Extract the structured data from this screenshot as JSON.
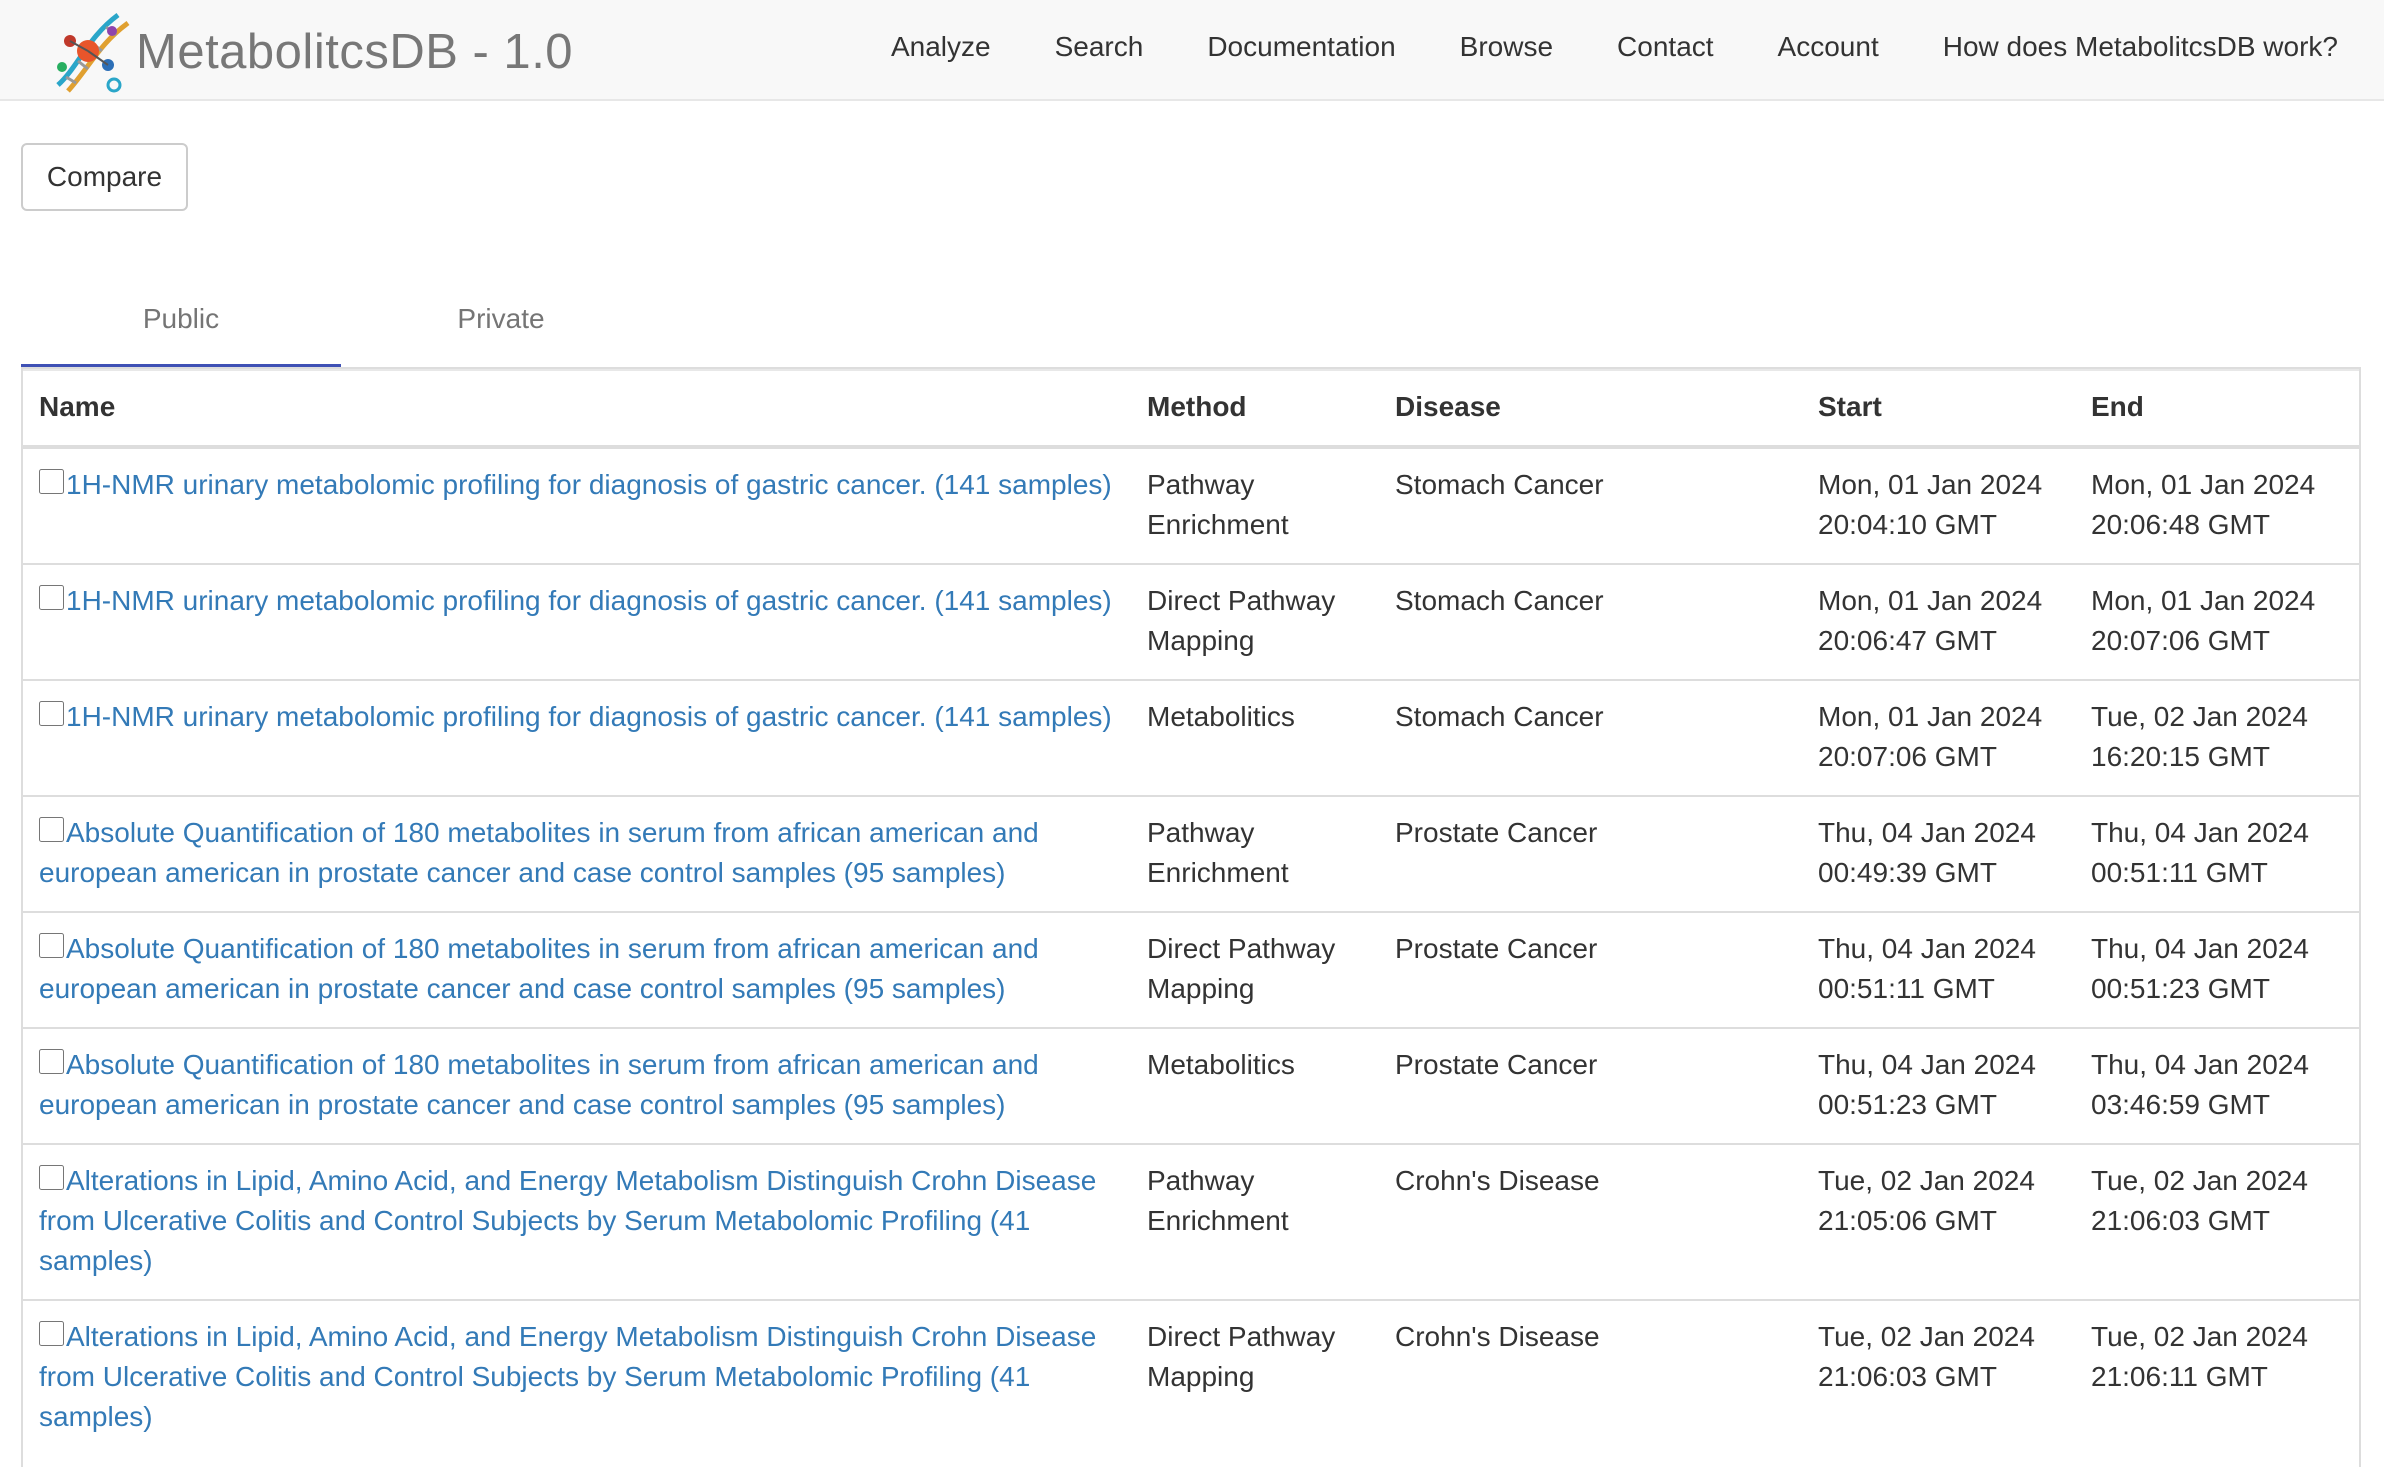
{
  "brand": {
    "title": "MetabolitcsDB - 1.0",
    "logo_icon": "dna-molecule-icon"
  },
  "nav": [
    {
      "label": "Analyze"
    },
    {
      "label": "Search"
    },
    {
      "label": "Documentation"
    },
    {
      "label": "Browse"
    },
    {
      "label": "Contact"
    },
    {
      "label": "Account"
    },
    {
      "label": "How does MetabolitcsDB work?"
    }
  ],
  "toolbar": {
    "compare_label": "Compare"
  },
  "tabs": [
    {
      "label": "Public",
      "active": true
    },
    {
      "label": "Private",
      "active": false
    }
  ],
  "table": {
    "headers": {
      "name": "Name",
      "method": "Method",
      "disease": "Disease",
      "start": "Start",
      "end": "End"
    },
    "rows": [
      {
        "name": "1H-NMR urinary metabolomic profiling for diagnosis of gastric cancer. (141 samples)",
        "method": "Pathway Enrichment",
        "disease": "Stomach Cancer",
        "start": "Mon, 01 Jan 2024 20:04:10 GMT",
        "end": "Mon, 01 Jan 2024 20:06:48 GMT"
      },
      {
        "name": "1H-NMR urinary metabolomic profiling for diagnosis of gastric cancer. (141 samples)",
        "method": "Direct Pathway Mapping",
        "disease": "Stomach Cancer",
        "start": "Mon, 01 Jan 2024 20:06:47 GMT",
        "end": "Mon, 01 Jan 2024 20:07:06 GMT"
      },
      {
        "name": "1H-NMR urinary metabolomic profiling for diagnosis of gastric cancer. (141 samples)",
        "method": "Metabolitics",
        "disease": "Stomach Cancer",
        "start": "Mon, 01 Jan 2024 20:07:06 GMT",
        "end": "Tue, 02 Jan 2024 16:20:15 GMT"
      },
      {
        "name": "Absolute Quantification of 180 metabolites in serum from african american and european american in prostate cancer and case control samples (95 samples)",
        "method": "Pathway Enrichment",
        "disease": "Prostate Cancer",
        "start": "Thu, 04 Jan 2024 00:49:39 GMT",
        "end": "Thu, 04 Jan 2024 00:51:11 GMT"
      },
      {
        "name": "Absolute Quantification of 180 metabolites in serum from african american and european american in prostate cancer and case control samples (95 samples)",
        "method": "Direct Pathway Mapping",
        "disease": "Prostate Cancer",
        "start": "Thu, 04 Jan 2024 00:51:11 GMT",
        "end": "Thu, 04 Jan 2024 00:51:23 GMT"
      },
      {
        "name": "Absolute Quantification of 180 metabolites in serum from african american and european american in prostate cancer and case control samples (95 samples)",
        "method": "Metabolitics",
        "disease": "Prostate Cancer",
        "start": "Thu, 04 Jan 2024 00:51:23 GMT",
        "end": "Thu, 04 Jan 2024 03:46:59 GMT"
      },
      {
        "name": "Alterations in Lipid, Amino Acid, and Energy Metabolism Distinguish Crohn Disease from Ulcerative Colitis and Control Subjects by Serum Metabolomic Profiling (41 samples)",
        "method": "Pathway Enrichment",
        "disease": "Crohn's Disease",
        "start": "Tue, 02 Jan 2024 21:05:06 GMT",
        "end": "Tue, 02 Jan 2024 21:06:03 GMT"
      },
      {
        "name": "Alterations in Lipid, Amino Acid, and Energy Metabolism Distinguish Crohn Disease from Ulcerative Colitis and Control Subjects by Serum Metabolomic Profiling (41 samples)",
        "method": "Direct Pathway Mapping",
        "disease": "Crohn's Disease",
        "start": "Tue, 02 Jan 2024 21:06:03 GMT",
        "end": "Tue, 02 Jan 2024 21:06:11 GMT"
      }
    ]
  },
  "colors": {
    "link": "#337ab7",
    "tab_active": "#3f51b5",
    "navbar_bg": "#f8f8f8"
  }
}
